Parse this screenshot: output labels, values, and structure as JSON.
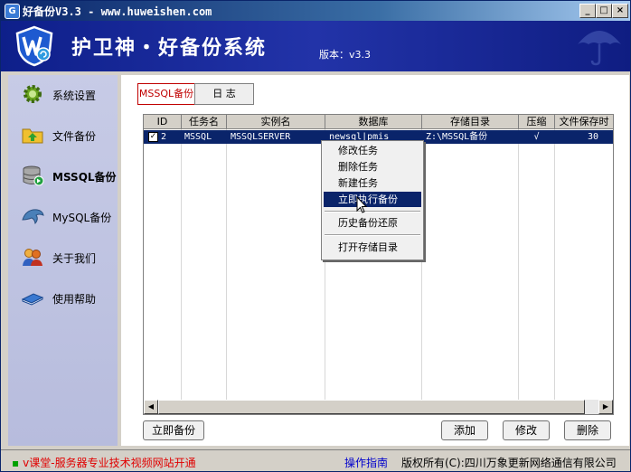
{
  "window": {
    "title": "好备份V3.3 - www.huweishen.com",
    "controls": {
      "minimize": "_",
      "maximize": "□",
      "close": "×"
    }
  },
  "banner": {
    "brand": "护卫神・好备份系统",
    "version": "版本：v3.3"
  },
  "sidebar": {
    "items": [
      {
        "label": "系统设置",
        "icon": "gear-icon"
      },
      {
        "label": "文件备份",
        "icon": "folder-icon"
      },
      {
        "label": "MSSQL备份",
        "icon": "database-icon",
        "active": true
      },
      {
        "label": "MySQL备份",
        "icon": "dolphin-icon"
      },
      {
        "label": "关于我们",
        "icon": "people-icon"
      },
      {
        "label": "使用帮助",
        "icon": "book-icon"
      }
    ]
  },
  "tabs": [
    {
      "label": "MSSQL备份",
      "active": true
    },
    {
      "label": "日 志",
      "active": false
    }
  ],
  "table": {
    "columns": [
      "ID",
      "任务名",
      "实例名",
      "数据库",
      "存储目录",
      "压缩",
      "文件保存时"
    ],
    "rows": [
      {
        "checked": true,
        "id": "2",
        "task": "MSSQL",
        "instance": "MSSQLSERVER",
        "database": "newsql|pmis",
        "dir": "Z:\\MSSQL备份",
        "compress": "√",
        "keep": "30"
      }
    ]
  },
  "context_menu": {
    "items": [
      "修改任务",
      "删除任务",
      "新建任务",
      "立即执行备份",
      "历史备份还原",
      "打开存储目录"
    ],
    "highlighted": "立即执行备份"
  },
  "buttons": {
    "backup_now": "立即备份",
    "add": "添加",
    "edit": "修改",
    "delete": "删除"
  },
  "statusbar": {
    "promo": "v课堂-服务器专业技术视频网站开通",
    "guide": "操作指南",
    "copyright": "版权所有(C):四川万象更新网络通信有限公司"
  },
  "colors": {
    "selection": "#0a246a",
    "banner": "#1a2a9a",
    "active_tab": "#c00000",
    "promo_text": "#e00000",
    "link": "#0000cc"
  }
}
